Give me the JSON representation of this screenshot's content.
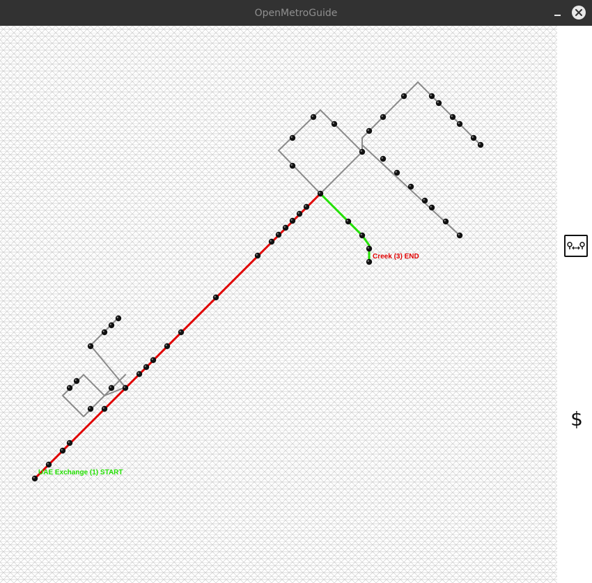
{
  "window": {
    "title": "OpenMetroGuide"
  },
  "map": {
    "start_label": "UAE Exchange (1) START",
    "end_label": "Creek (3) END",
    "colors": {
      "grid": "#cfcfcf",
      "line": "#8a8a8a",
      "route_red": "#e00000",
      "route_green": "#22e000",
      "station": "#111111",
      "start_text": "#22e000",
      "end_text": "#e00000"
    }
  },
  "sidebar": {
    "route_icon": "route-pins-icon",
    "fare_icon": "dollar-icon",
    "fare_symbol": "$"
  }
}
